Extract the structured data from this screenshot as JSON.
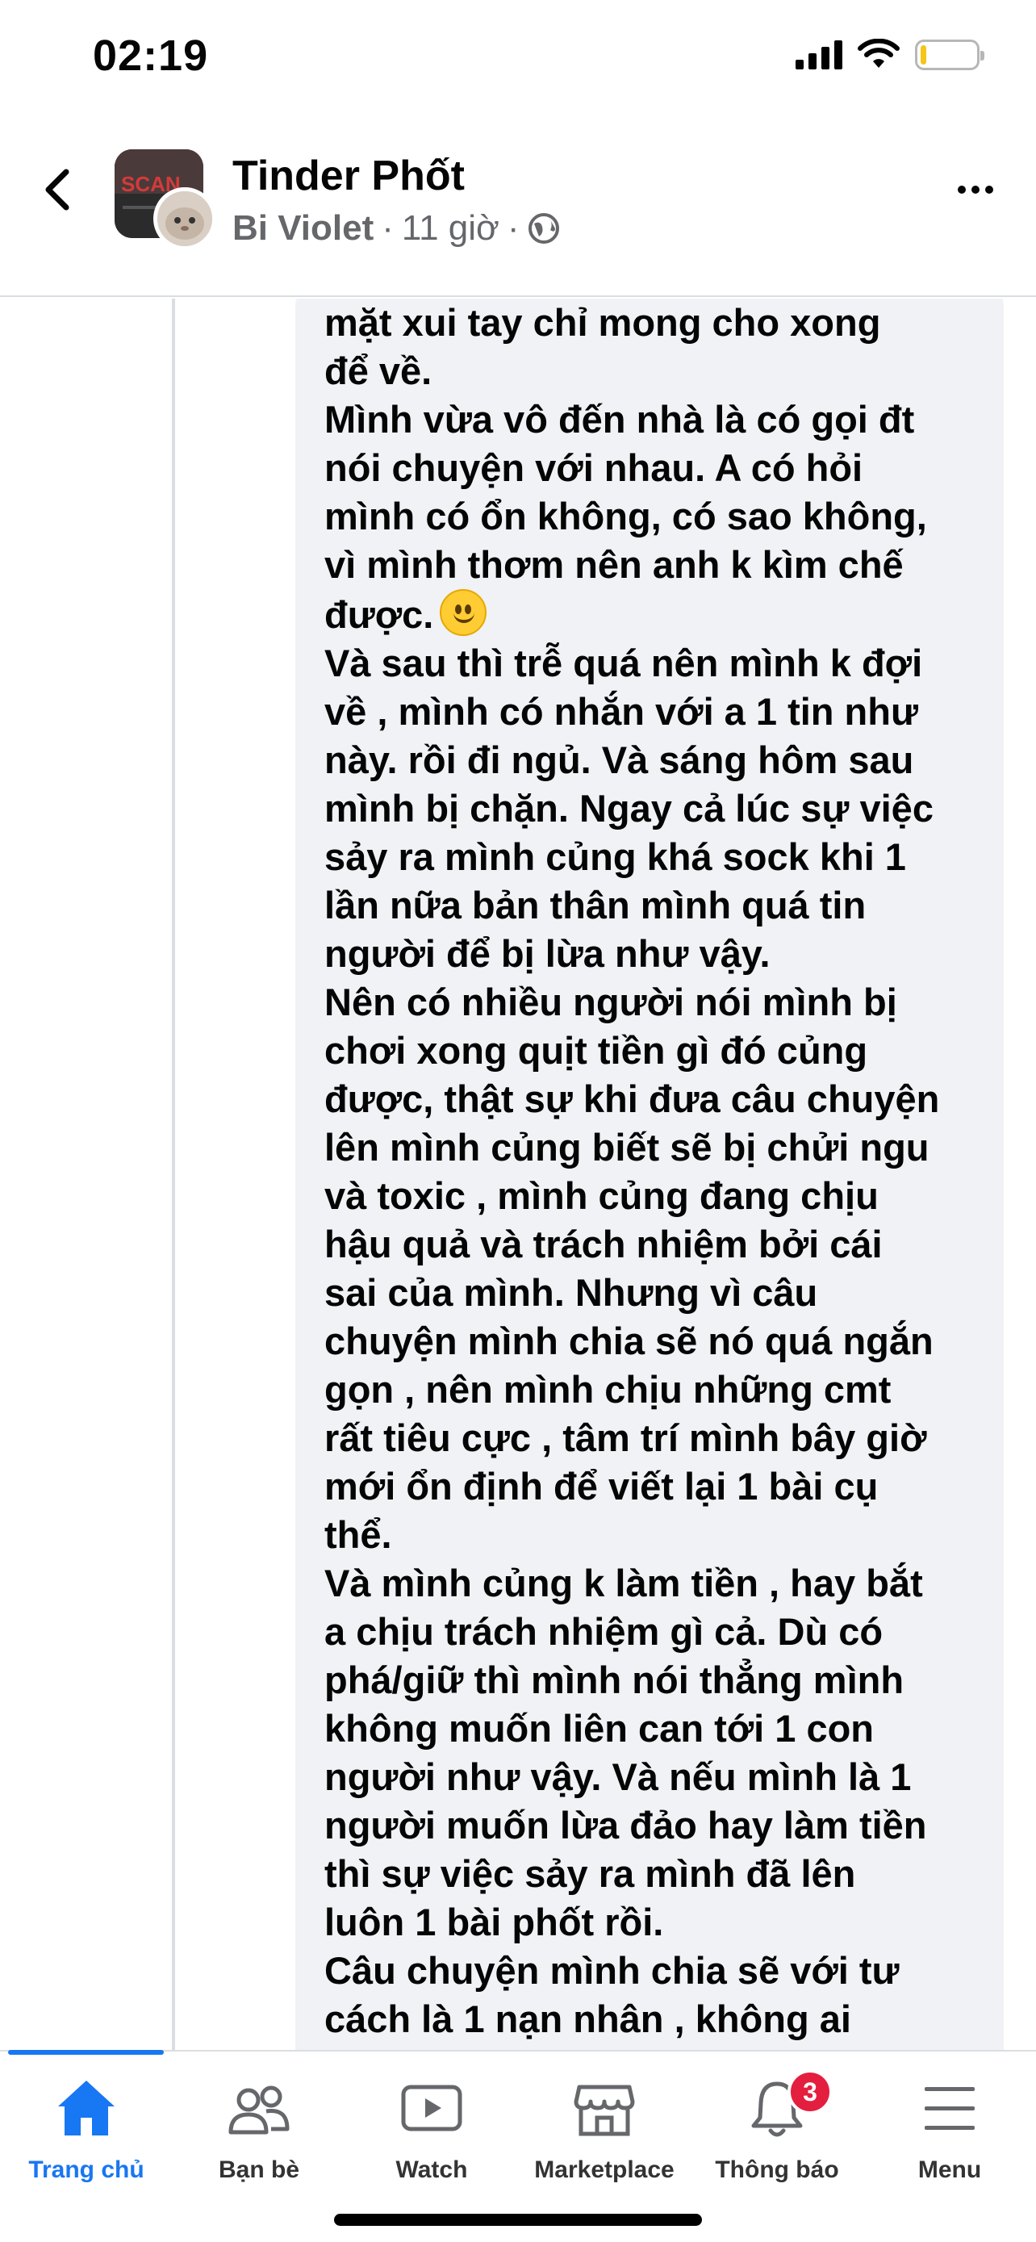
{
  "status_bar": {
    "time": "02:19",
    "icons": [
      "cellular-signal-icon",
      "wifi-icon",
      "battery-icon"
    ],
    "battery_level": 0.1
  },
  "header": {
    "group_name": "Tinder Phốt",
    "author": "Bi Violet",
    "separator": "·",
    "time_ago": "11 giờ",
    "avatar_text": "SCAN",
    "icons": [
      "back-chevron-icon",
      "globe-icon",
      "more-dots-icon"
    ]
  },
  "comment": {
    "paragraphs": [
      "mặt xui tay chỉ mong cho xong\nđể về.",
      "Mình vừa vô đến nhà là có gọi đt\nnói chuyện với nhau. A có hỏi\nmình có ổn không, có sao không,\nvì mình thơm nên anh k kìm chế\nđược.",
      "Và sau thì trễ quá nên mình k đợi\nvề , mình có nhắn với a 1 tin như\nnày. rồi đi ngủ. Và sáng hôm sau\nmình bị chặn. Ngay cả lúc sự việc\nsảy ra mình củng khá sock khi 1\nlần nữa bản thân mình quá tin\nngười để bị lừa như vậy.",
      "Nên có nhiều người nói mình bị\nchơi xong quịt tiền gì đó củng\nđược, thật sự khi đưa câu chuyện\nlên mình củng biết sẽ bị chửi ngu\nvà toxic , mình củng đang chịu\nhậu quả và trách nhiệm bởi cái\nsai của mình. Nhưng vì câu\nchuyện mình chia sẽ nó quá ngắn\ngọn , nên mình chịu những cmt\nrất tiêu cực , tâm trí mình bây giờ\nmới ổn định để viết lại 1 bài cụ\nthể.",
      "Và mình củng k làm tiền , hay bắt\na chịu trách nhiệm gì cả. Dù có\nphá/giữ thì mình nói thẳng mình\nkhông muốn liên can tới 1 con\nngười như vậy. Và nếu mình là 1\nngười muốn lừa đảo hay làm tiền\nthì sự việc sảy ra mình đã lên\nluôn 1 bài phốt rồi.",
      "Câu chuyện mình chia sẽ với tư\ncách là 1 nạn nhân , không ai"
    ],
    "emoji": "slightly-smiling-face-icon"
  },
  "tab_bar": {
    "tabs": [
      {
        "label": "Trang chủ",
        "icon": "home-icon",
        "active": true
      },
      {
        "label": "Bạn bè",
        "icon": "friends-icon",
        "active": false
      },
      {
        "label": "Watch",
        "icon": "watch-icon",
        "active": false
      },
      {
        "label": "Marketplace",
        "icon": "marketplace-icon",
        "active": false
      },
      {
        "label": "Thông báo",
        "icon": "bell-icon",
        "active": false,
        "badge": "3"
      },
      {
        "label": "Menu",
        "icon": "menu-icon",
        "active": false
      }
    ],
    "colors": {
      "active": "#1877f2",
      "inactive": "#333333",
      "badge": "#e41e3f"
    }
  }
}
